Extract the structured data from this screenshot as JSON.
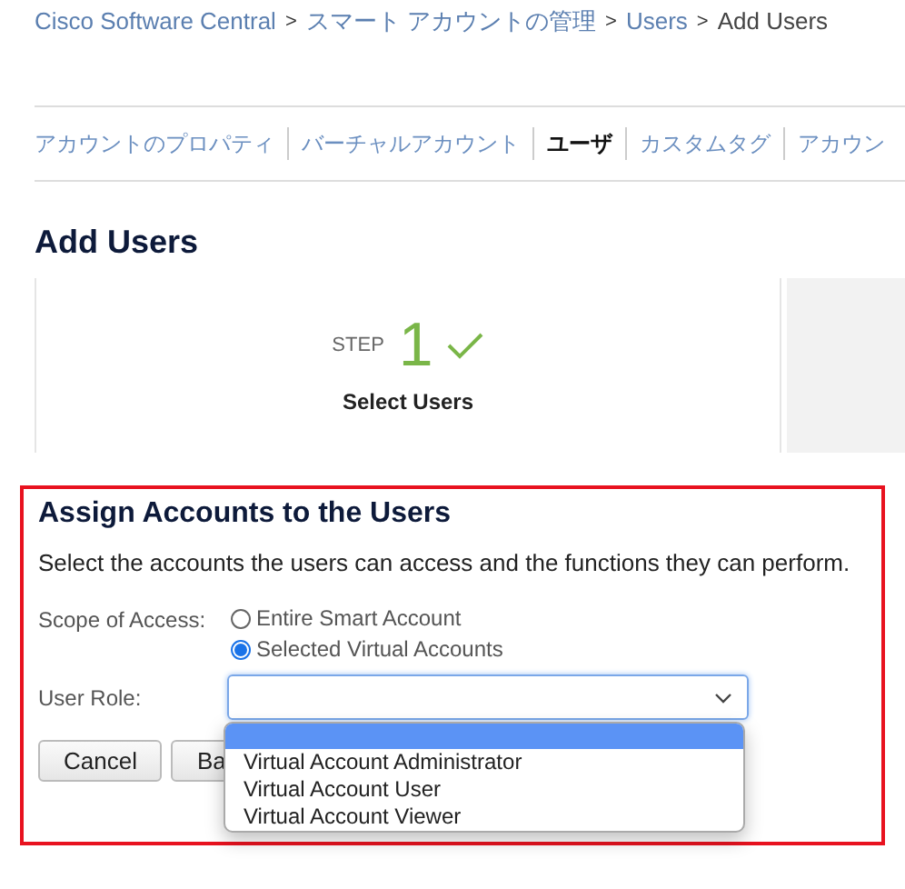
{
  "breadcrumb": [
    {
      "label": "Cisco Software Central",
      "link": true
    },
    {
      "label": "スマート アカウントの管理",
      "link": true
    },
    {
      "label": "Users",
      "link": true
    },
    {
      "label": "Add Users",
      "link": false
    }
  ],
  "separator": ">",
  "tabs": [
    {
      "label": "アカウントのプロパティ",
      "selected": false
    },
    {
      "label": "バーチャルアカウント",
      "selected": false
    },
    {
      "label": "ユーザ",
      "selected": true
    },
    {
      "label": "カスタムタグ",
      "selected": false
    },
    {
      "label": "アカウン",
      "selected": false
    }
  ],
  "page_title": "Add Users",
  "step": {
    "word": "STEP",
    "number": "1",
    "done": true,
    "label": "Select Users"
  },
  "section": {
    "title": "Assign Accounts to the Users",
    "description": "Select the accounts the users can access and the functions they can perform.",
    "scope_label": "Scope of Access:",
    "scope_options": [
      {
        "label": "Entire Smart Account",
        "selected": false
      },
      {
        "label": "Selected Virtual Accounts",
        "selected": true
      }
    ],
    "role_label": "User Role:",
    "role_dropdown": {
      "expanded": true,
      "blank_option_highlighted": true,
      "options": [
        {
          "label": "Virtual Account Administrator"
        },
        {
          "label": "Virtual Account User"
        },
        {
          "label": "Virtual Account Viewer"
        }
      ]
    },
    "buttons": [
      {
        "label": "Cancel"
      },
      {
        "label": "Ba"
      }
    ]
  }
}
